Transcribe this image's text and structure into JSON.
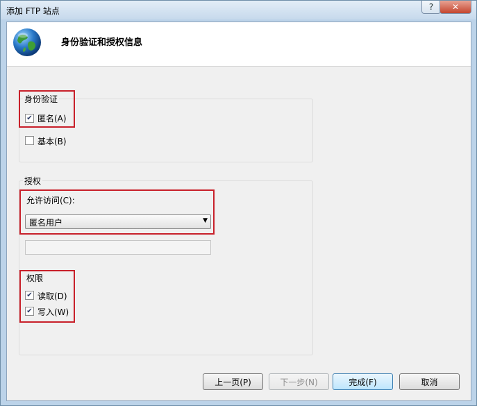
{
  "window": {
    "title": "添加 FTP 站点",
    "help_label": "?",
    "close_label": "✕"
  },
  "header": {
    "title": "身份验证和授权信息",
    "icon": "globe-icon"
  },
  "authentication": {
    "label": "身份验证",
    "anonymous": {
      "label": "匿名(A)",
      "checked": true
    },
    "basic": {
      "label": "基本(B)",
      "checked": false
    }
  },
  "authorization": {
    "label": "授权",
    "allow_access_label": "允许访问(C):",
    "allow_access_value": "匿名用户",
    "permissions": {
      "label": "权限",
      "read": {
        "label": "读取(D)",
        "checked": true
      },
      "write": {
        "label": "写入(W)",
        "checked": true
      }
    }
  },
  "buttons": {
    "previous": "上一页(P)",
    "next": "下一步(N)",
    "finish": "完成(F)",
    "cancel": "取消"
  },
  "colors": {
    "highlight": "#c8202a",
    "title_bar": "#c6d9ec",
    "dialog_bg": "#f0f0f0"
  }
}
